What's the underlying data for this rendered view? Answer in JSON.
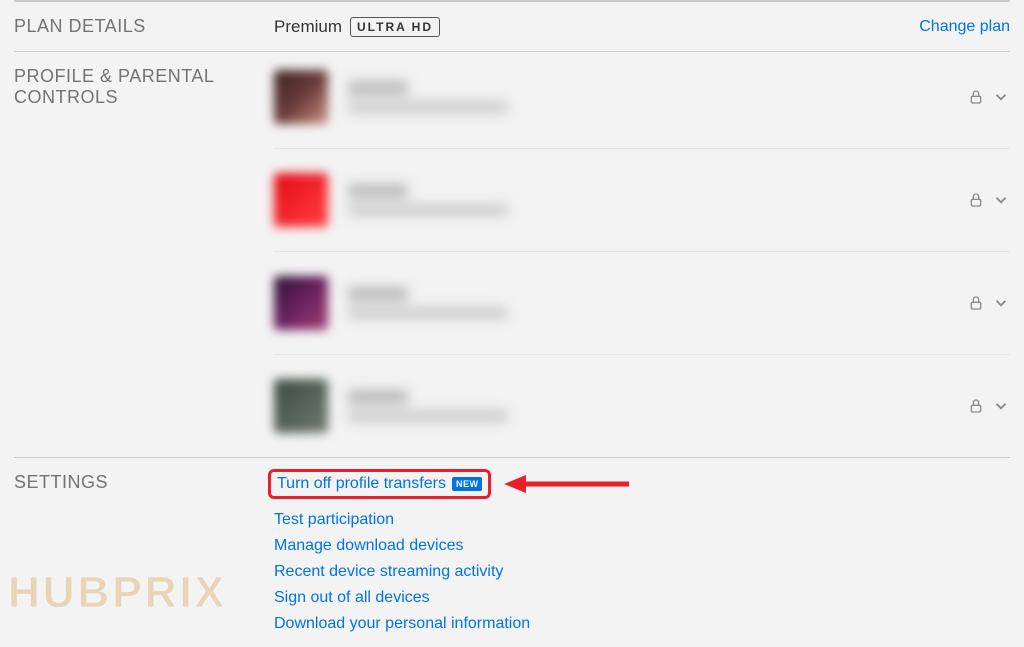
{
  "plan": {
    "section_label": "PLAN DETAILS",
    "name": "Premium",
    "badge": "ULTRA HD",
    "change_link": "Change plan"
  },
  "profiles": {
    "section_label": "PROFILE & PARENTAL CONTROLS"
  },
  "settings": {
    "section_label": "SETTINGS",
    "links": {
      "turn_off_transfers": "Turn off profile transfers",
      "new_badge": "NEW",
      "test_participation": "Test participation",
      "manage_downloads": "Manage download devices",
      "recent_activity": "Recent device streaming activity",
      "sign_out_all": "Sign out of all devices",
      "download_info": "Download your personal information"
    }
  },
  "watermark": "HUBPRIX"
}
